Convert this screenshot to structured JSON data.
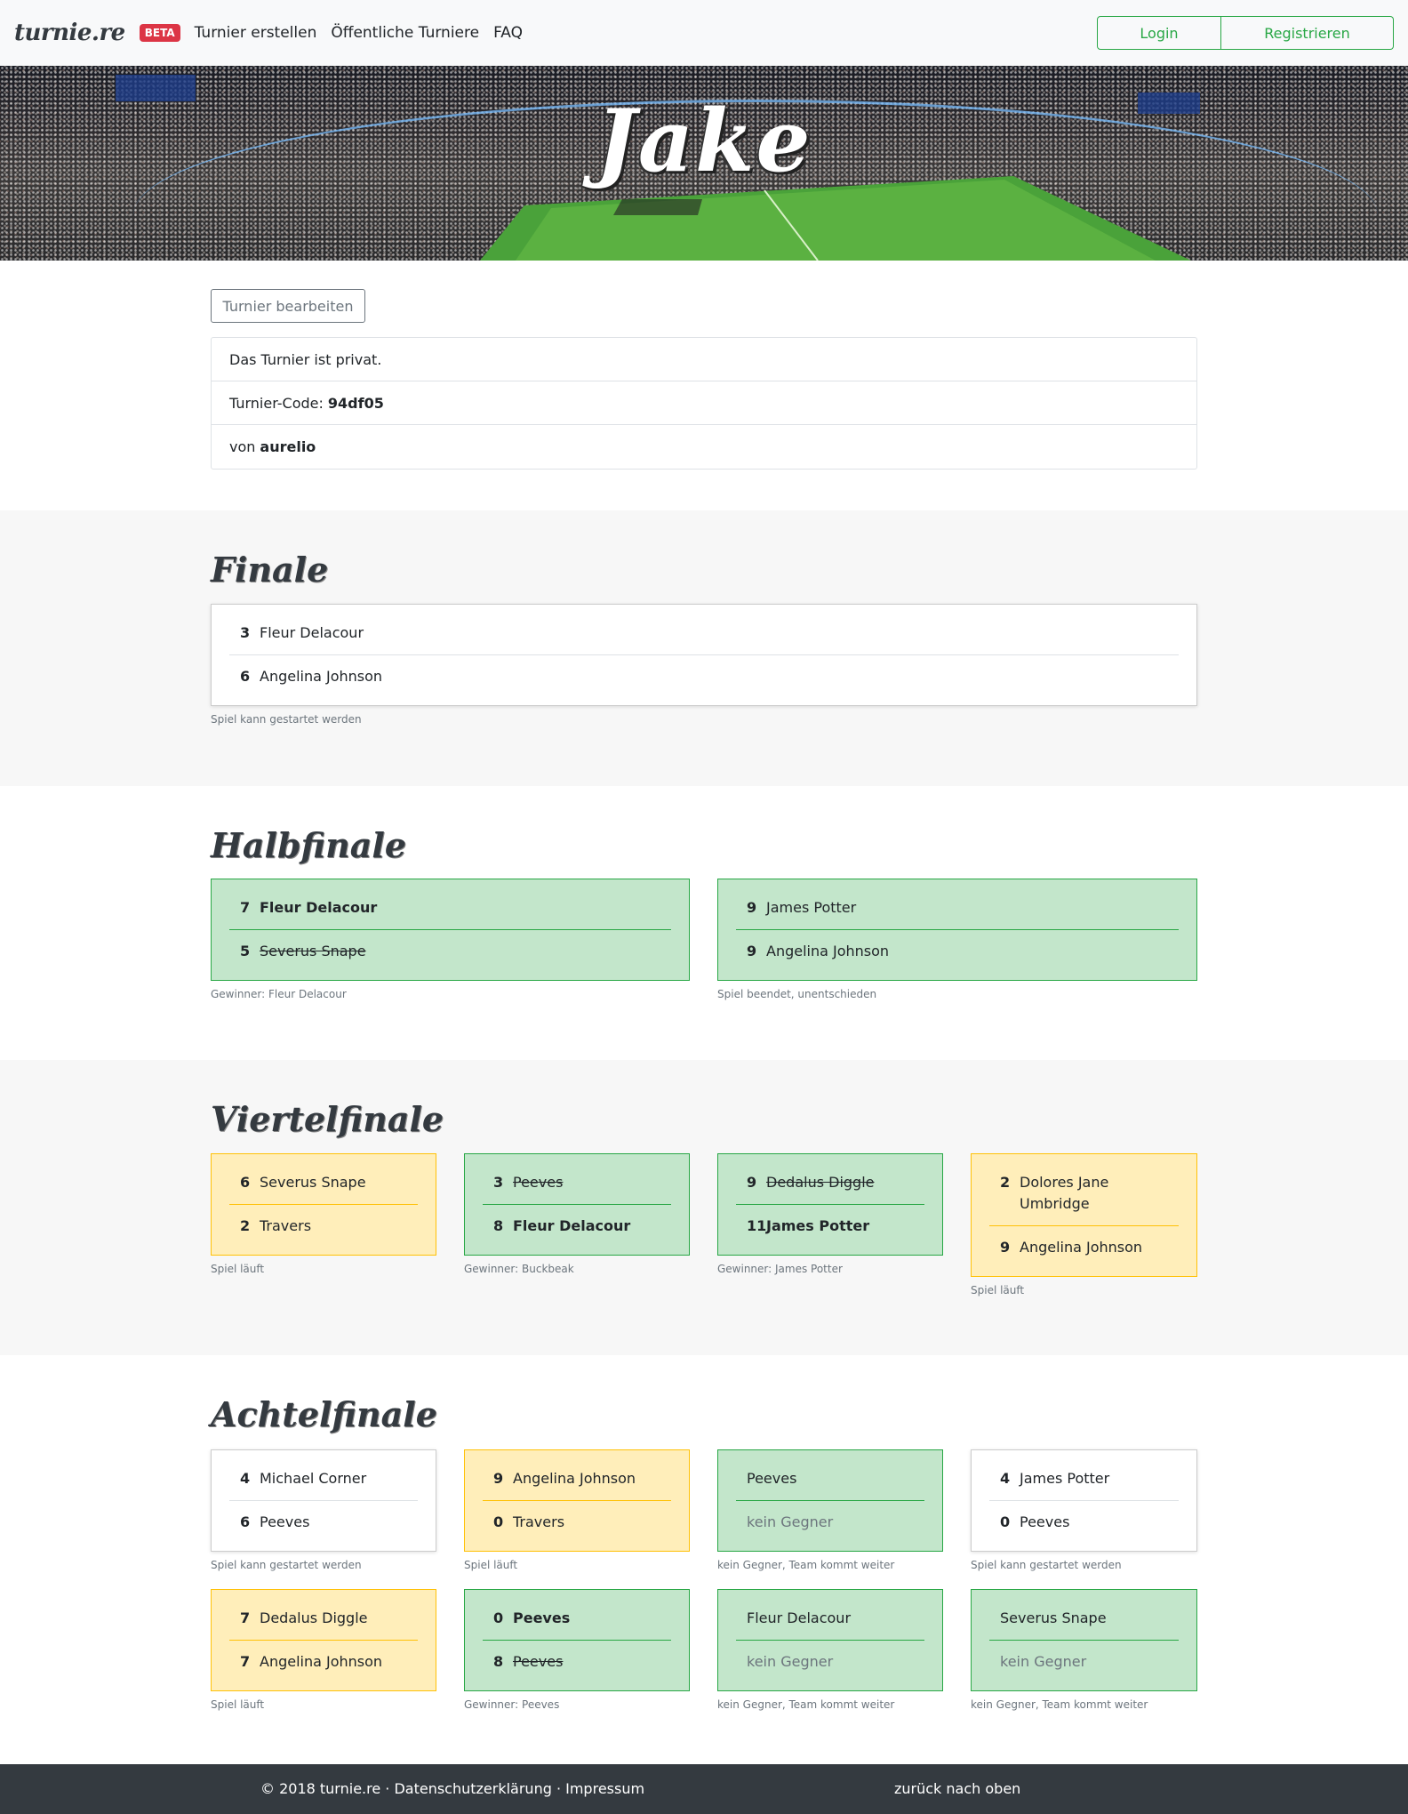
{
  "nav": {
    "brand": "turnie.re",
    "beta": "BETA",
    "links": [
      "Turnier erstellen",
      "Öffentliche Turniere",
      "FAQ"
    ],
    "login": "Login",
    "register": "Registrieren"
  },
  "hero": {
    "title": "Jake"
  },
  "info": {
    "edit_button": "Turnier bearbeiten",
    "private_text": "Das Turnier ist privat.",
    "code_label": "Turnier-Code:",
    "code_value": "94df05",
    "owner_label": "von",
    "owner_value": "aurelio"
  },
  "stages": {
    "final": {
      "title": "Finale",
      "matches": [
        {
          "state": "white",
          "teams": [
            {
              "score": "3",
              "name": "Fleur Delacour",
              "style": ""
            },
            {
              "score": "6",
              "name": "Angelina Johnson",
              "style": ""
            }
          ],
          "caption": "Spiel kann gestartet werden"
        }
      ]
    },
    "semi": {
      "title": "Halbfinale",
      "matches": [
        {
          "state": "green",
          "teams": [
            {
              "score": "7",
              "name": "Fleur Delacour",
              "style": "win"
            },
            {
              "score": "5",
              "name": "Severus Snape",
              "style": "lose"
            }
          ],
          "caption": "Gewinner: Fleur Delacour"
        },
        {
          "state": "green",
          "teams": [
            {
              "score": "9",
              "name": "James Potter",
              "style": ""
            },
            {
              "score": "9",
              "name": "Angelina Johnson",
              "style": ""
            }
          ],
          "caption": "Spiel beendet, unentschieden"
        }
      ]
    },
    "quarter": {
      "title": "Viertelfinale",
      "matches": [
        {
          "state": "yellow",
          "teams": [
            {
              "score": "6",
              "name": "Severus Snape",
              "style": ""
            },
            {
              "score": "2",
              "name": "Travers",
              "style": ""
            }
          ],
          "caption": "Spiel läuft"
        },
        {
          "state": "green",
          "teams": [
            {
              "score": "3",
              "name": "Peeves",
              "style": "lose"
            },
            {
              "score": "8",
              "name": "Fleur Delacour",
              "style": "win"
            }
          ],
          "caption": "Gewinner: Buckbeak"
        },
        {
          "state": "green",
          "teams": [
            {
              "score": "9",
              "name": "Dedalus Diggle",
              "style": "lose"
            },
            {
              "score": "11",
              "name": "James Potter",
              "style": "win"
            }
          ],
          "caption": "Gewinner: James Potter"
        },
        {
          "state": "yellow",
          "teams": [
            {
              "score": "2",
              "name": "Dolores Jane Umbridge",
              "style": ""
            },
            {
              "score": "9",
              "name": "Angelina Johnson",
              "style": ""
            }
          ],
          "caption": "Spiel läuft"
        }
      ]
    },
    "eighth": {
      "title": "Achtelfinale",
      "matches": [
        {
          "state": "white",
          "teams": [
            {
              "score": "4",
              "name": "Michael Corner",
              "style": ""
            },
            {
              "score": "6",
              "name": "Peeves",
              "style": ""
            }
          ],
          "caption": "Spiel kann gestartet werden"
        },
        {
          "state": "yellow",
          "teams": [
            {
              "score": "9",
              "name": "Angelina Johnson",
              "style": ""
            },
            {
              "score": "0",
              "name": "Travers",
              "style": ""
            }
          ],
          "caption": "Spiel läuft"
        },
        {
          "state": "green",
          "teams": [
            {
              "score": "",
              "name": "Peeves",
              "style": ""
            },
            {
              "score": "",
              "name": "kein Gegner",
              "style": "none"
            }
          ],
          "caption": "kein Gegner, Team kommt weiter"
        },
        {
          "state": "white",
          "teams": [
            {
              "score": "4",
              "name": "James Potter",
              "style": ""
            },
            {
              "score": "0",
              "name": "Peeves",
              "style": ""
            }
          ],
          "caption": "Spiel kann gestartet werden"
        },
        {
          "state": "yellow",
          "teams": [
            {
              "score": "7",
              "name": "Dedalus Diggle",
              "style": ""
            },
            {
              "score": "7",
              "name": "Angelina Johnson",
              "style": ""
            }
          ],
          "caption": "Spiel läuft"
        },
        {
          "state": "green",
          "teams": [
            {
              "score": "0",
              "name": "Peeves",
              "style": "win"
            },
            {
              "score": "8",
              "name": "Peeves",
              "style": "lose"
            }
          ],
          "caption": "Gewinner: Peeves"
        },
        {
          "state": "green",
          "teams": [
            {
              "score": "",
              "name": "Fleur Delacour",
              "style": ""
            },
            {
              "score": "",
              "name": "kein Gegner",
              "style": "none"
            }
          ],
          "caption": "kein Gegner, Team kommt weiter"
        },
        {
          "state": "green",
          "teams": [
            {
              "score": "",
              "name": "Severus Snape",
              "style": ""
            },
            {
              "score": "",
              "name": "kein Gegner",
              "style": "none"
            }
          ],
          "caption": "kein Gegner, Team kommt weiter"
        }
      ]
    }
  },
  "footer": {
    "links": "© 2018 turnie.re · Datenschutzerklärung · Impressum",
    "back_to_top": "zurück nach oben"
  },
  "colors": {
    "finished": "#c3e6cb",
    "running": "#ffeeba",
    "brand_accent": "#28a745",
    "beta_badge": "#dc3545"
  }
}
